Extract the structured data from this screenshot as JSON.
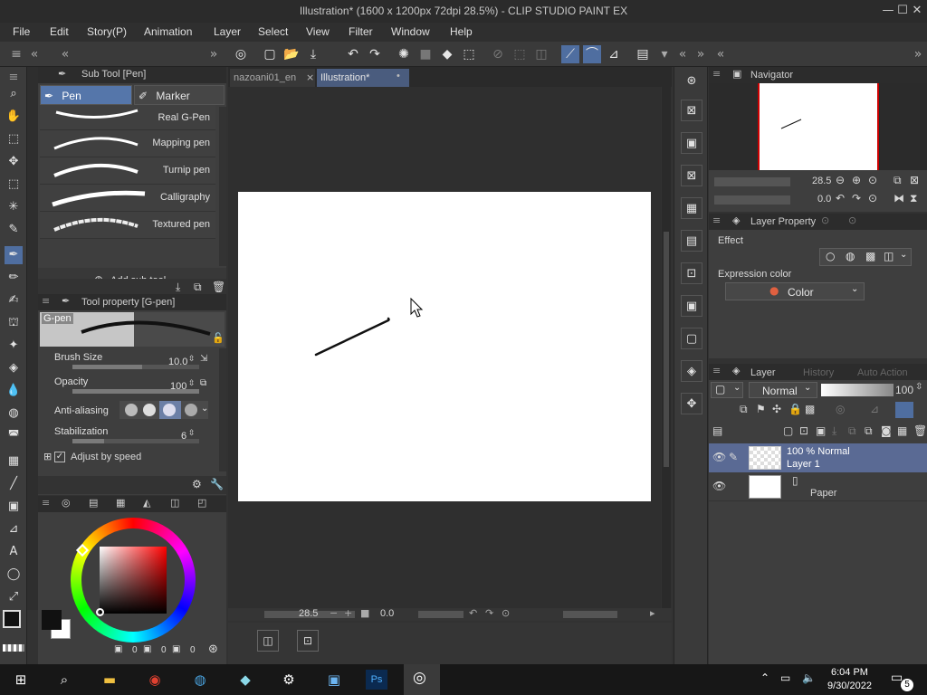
{
  "window": {
    "title": "Illustration* (1600 x 1200px 72dpi 28.5%) - CLIP STUDIO PAINT EX",
    "minimize": "—",
    "maximize": "☐",
    "close": "✕"
  },
  "menu": [
    "File",
    "Edit",
    "Story(P)",
    "Animation",
    "Layer",
    "Select",
    "View",
    "Filter",
    "Window",
    "Help"
  ],
  "subtool": {
    "header": "Sub Tool [Pen]",
    "tabs": [
      "Pen",
      "Marker"
    ],
    "brushes": [
      "Real G-Pen",
      "Mapping pen",
      "Turnip pen",
      "Calligraphy",
      "Textured pen"
    ],
    "add_label": "Add sub tool"
  },
  "toolprop": {
    "header": "Tool property [G-pen]",
    "preset_name": "G-pen",
    "rows": [
      {
        "label": "Brush Size",
        "value": "10.0",
        "level": 0.55
      },
      {
        "label": "Opacity",
        "value": "100",
        "level": 1.0
      },
      {
        "label": "Anti-aliasing",
        "value": ""
      },
      {
        "label": "Stabilization",
        "value": "6",
        "level": 0.25
      }
    ],
    "adjust_label": "Adjust by speed"
  },
  "color": {
    "main": "#111111",
    "sub": "#ffffff",
    "readout": [
      "0",
      "0",
      "0"
    ]
  },
  "doc_tabs": [
    {
      "label": "nazoani01_en",
      "active": false
    },
    {
      "label": "Illustration*",
      "active": true
    }
  ],
  "canvas": {
    "zoom": "28.5",
    "rotation": "0.0"
  },
  "navigator": {
    "header": "Navigator",
    "zoom": "28.5",
    "rotation": "0.0"
  },
  "layer_property": {
    "header": "Layer Property",
    "effect_label": "Effect",
    "expression_label": "Expression color",
    "expression_value": "Color"
  },
  "layers": {
    "tabs": [
      "Layer",
      "History",
      "Auto Action"
    ],
    "blend_mode": "Normal",
    "opacity": "100",
    "items": [
      {
        "line1": "100 % Normal",
        "line2": "Layer 1",
        "selected": true
      },
      {
        "line1": "",
        "line2": "Paper",
        "selected": false
      }
    ]
  },
  "taskbar": {
    "time": "6:04 PM",
    "date": "9/30/2022",
    "notifications": "5"
  }
}
